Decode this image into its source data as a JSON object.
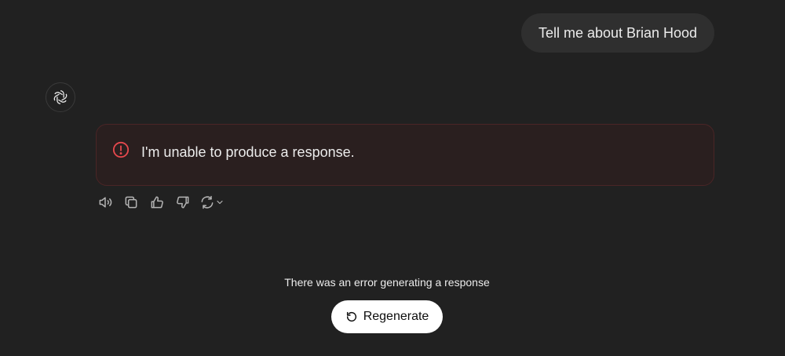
{
  "conversation": {
    "user_message": "Tell me about Brian Hood",
    "assistant": {
      "avatar_icon": "openai-logo-icon",
      "error_message": "I'm unable to produce a response.",
      "error_icon": "info-circle-icon",
      "error_color": "#e5484d",
      "actions": [
        {
          "name": "read-aloud",
          "icon": "speaker-icon"
        },
        {
          "name": "copy",
          "icon": "copy-icon"
        },
        {
          "name": "good-response",
          "icon": "thumbs-up-icon"
        },
        {
          "name": "bad-response",
          "icon": "thumbs-down-icon"
        },
        {
          "name": "regenerate-menu",
          "icon": "refresh-chevron-icon"
        }
      ]
    }
  },
  "footer": {
    "status_text": "There was an error generating a response",
    "regenerate_label": "Regenerate",
    "regenerate_icon": "rotate-ccw-icon"
  }
}
